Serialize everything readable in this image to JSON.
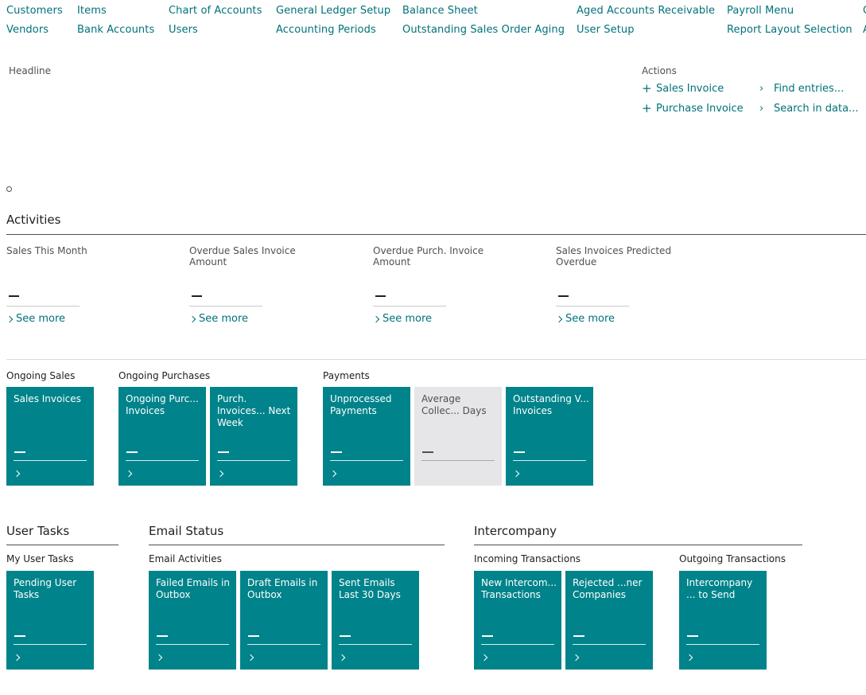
{
  "nav": {
    "customers": "Customers",
    "vendors": "Vendors",
    "items": "Items",
    "bank_accounts": "Bank Accounts",
    "chart_of_accounts": "Chart of Accounts",
    "users": "Users",
    "general_ledger_setup": "General Ledger Setup",
    "accounting_periods": "Accounting Periods",
    "balance_sheet": "Balance Sheet",
    "outstanding_sales_order_aging": "Outstanding Sales Order Aging",
    "aged_accounts_receivable": "Aged Accounts Receivable",
    "user_setup": "User Setup",
    "payroll_menu": "Payroll Menu",
    "report_layout_selection": "Report Layout Selection",
    "clipped_1": "C",
    "clipped_2": "A"
  },
  "headline": {
    "label": "Headline"
  },
  "actions": {
    "label": "Actions",
    "sales_invoice": "Sales Invoice",
    "purchase_invoice": "Purchase Invoice",
    "find_entries": "Find entries...",
    "search_in_data": "Search in data..."
  },
  "activities": {
    "title": "Activities",
    "cues": [
      {
        "caption": "Sales This Month",
        "see_more": "See more"
      },
      {
        "caption": "Overdue Sales Invoice Amount",
        "see_more": "See more"
      },
      {
        "caption": "Overdue Purch. Invoice Amount",
        "see_more": "See more"
      },
      {
        "caption": "Sales Invoices Predicted Overdue",
        "see_more": "See more"
      }
    ]
  },
  "groups": {
    "ongoing_sales": "Ongoing Sales",
    "ongoing_purchases": "Ongoing Purchases",
    "payments": "Payments",
    "my_user_tasks": "My User Tasks",
    "email_activities": "Email Activities",
    "incoming_transactions": "Incoming Transactions",
    "outgoing_transactions": "Outgoing Transactions"
  },
  "sections": {
    "user_tasks": "User Tasks",
    "email_status": "Email Status",
    "intercompany": "Intercompany"
  },
  "tiles": {
    "sales_invoices": "Sales Invoices",
    "ongoing_purchase_invoices": "Ongoing Purc... Invoices",
    "purch_invoices_next_week": "Purch. Invoices... Next Week",
    "unprocessed_payments": "Unprocessed Payments",
    "average_collection_days": "Average Collec... Days",
    "outstanding_vendor_invoices": "Outstanding V... Invoices",
    "pending_user_tasks": "Pending User Tasks",
    "failed_emails": "Failed Emails in Outbox",
    "draft_emails": "Draft Emails in Outbox",
    "sent_emails": "Sent Emails Last 30 Days",
    "new_intercompany": "New Intercom... Transactions",
    "rejected_partner": "Rejected ...ner Companies",
    "intercompany_to_send": "Intercompany ... to Send"
  },
  "colors": {
    "accent": "#00727a",
    "tile": "#00838a",
    "tile_disabled": "#e6e6e9"
  }
}
